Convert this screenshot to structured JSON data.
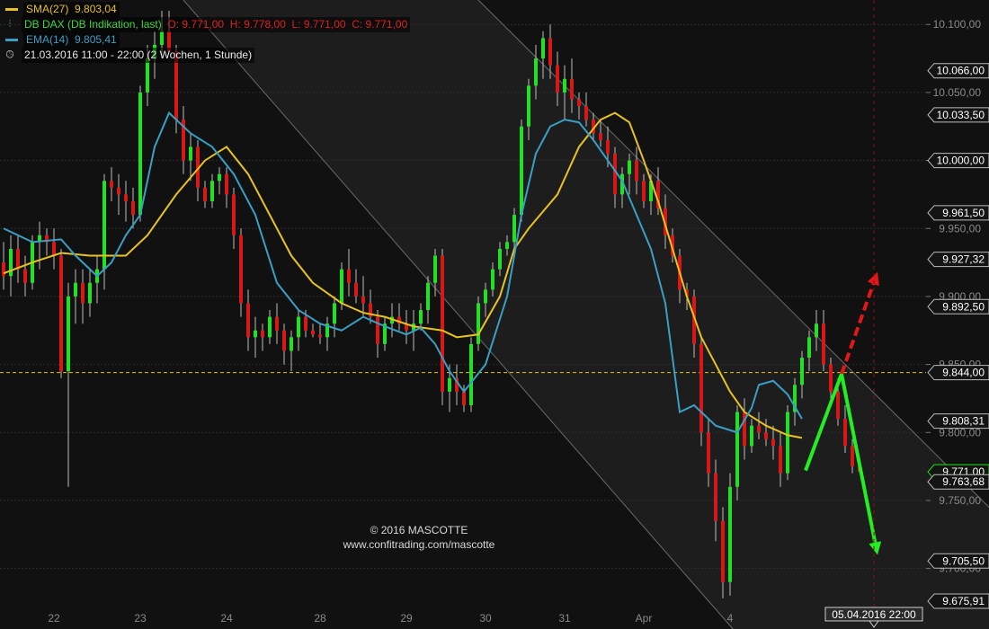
{
  "legend": {
    "sma_label": "SMA(27)",
    "sma_value": "9.803,04",
    "instrument_label": "DB DAX (DB Indikation, last)",
    "ohlc_text": "O: 9.771,00  H: 9.778,00  L: 9.771,00  C: 9.771,00",
    "ema_label": "EMA(14)",
    "ema_value": "9.805,41",
    "range_text": "21.03.2016 11:00 - 22:00 (2 Wochen, 1 Stunde)",
    "clock_icon": "clock-icon",
    "candle_icon": "candlestick-icon"
  },
  "watermark": {
    "line1": "© 2016 MASCOTTE",
    "line2": "www.confitrading.com/mascotte"
  },
  "colors": {
    "background": "#111111",
    "up": "#22e022",
    "down": "#d81818",
    "sma": "#e8c21e",
    "ema": "#3a9fc4",
    "channel": "#6a6a6a",
    "reference": "#e8c21e",
    "forecast_up": "#e01818",
    "forecast_down": "#22ee22"
  },
  "chart_data": {
    "type": "candlestick",
    "y_range": [
      9670,
      10118
    ],
    "y_ticks": [
      {
        "value": 10100,
        "label": "10.100,00"
      },
      {
        "value": 10050,
        "label": "10.050,00"
      },
      {
        "value": 10000,
        "label": "10.000,00"
      },
      {
        "value": 9950,
        "label": "9.950,00"
      },
      {
        "value": 9900,
        "label": "9.900,00"
      },
      {
        "value": 9850,
        "label": "9.850,00"
      },
      {
        "value": 9800,
        "label": "9.800,00"
      },
      {
        "value": 9750,
        "label": "9.750,00"
      },
      {
        "value": 9700,
        "label": "9.700,00"
      }
    ],
    "x_labels": [
      {
        "bar": 7,
        "label": "22"
      },
      {
        "bar": 19,
        "label": "23"
      },
      {
        "bar": 31,
        "label": "24"
      },
      {
        "bar": 44,
        "label": "28"
      },
      {
        "bar": 56,
        "label": "29"
      },
      {
        "bar": 67,
        "label": "30"
      },
      {
        "bar": 78,
        "label": "31"
      },
      {
        "bar": 89,
        "label": "Apr"
      },
      {
        "bar": 101,
        "label": "4"
      }
    ],
    "price_markers": [
      {
        "value": 10066,
        "label": "10.066,00",
        "style": "dark"
      },
      {
        "value": 10033.5,
        "label": "10.033,50",
        "style": "dark"
      },
      {
        "value": 10000,
        "label": "10.000,00",
        "style": "dark"
      },
      {
        "value": 9961.5,
        "label": "9.961,50",
        "style": "dark"
      },
      {
        "value": 9927.32,
        "label": "9.927,32",
        "style": "dark"
      },
      {
        "value": 9892.5,
        "label": "9.892,50",
        "style": "dark"
      },
      {
        "value": 9844,
        "label": "9.844,00",
        "style": "dark"
      },
      {
        "value": 9808.31,
        "label": "9.808,31",
        "style": "dark"
      },
      {
        "value": 9771,
        "label": "9.771,00",
        "style": "green"
      },
      {
        "value": 9763.68,
        "label": "9.763,68",
        "style": "dark"
      },
      {
        "value": 9705.5,
        "label": "9.705,50",
        "style": "dark"
      },
      {
        "value": 9675.91,
        "label": "9.675,91",
        "style": "dark"
      }
    ],
    "reference_line": {
      "value": 9844
    },
    "crosshair_label": "05.04.2016 22:00",
    "crosshair_bar": 121,
    "channel": {
      "upper": [
        {
          "bar": 66,
          "value": 10118
        },
        {
          "bar": 137,
          "value": 9745
        }
      ],
      "lower": [
        {
          "bar": 25,
          "value": 10118
        },
        {
          "bar": 99,
          "value": 9670
        }
      ]
    },
    "forecast": {
      "start": {
        "bar": 111.5,
        "value": 9772
      },
      "peak": {
        "bar": 116.5,
        "value": 9843
      },
      "up_target": {
        "bar": 121.5,
        "value": 9918
      },
      "down_target": {
        "bar": 121.5,
        "value": 9710
      }
    },
    "ohlc": [
      [
        9925,
        9940,
        9905,
        9915
      ],
      [
        9915,
        9945,
        9900,
        9935
      ],
      [
        9935,
        9945,
        9910,
        9920
      ],
      [
        9920,
        9930,
        9900,
        9910
      ],
      [
        9910,
        9945,
        9905,
        9940
      ],
      [
        9940,
        9955,
        9920,
        9945
      ],
      [
        9945,
        9950,
        9930,
        9940
      ],
      [
        9940,
        9950,
        9920,
        9930
      ],
      [
        9930,
        9935,
        9840,
        9845
      ],
      [
        9845,
        9910,
        9760,
        9900
      ],
      [
        9900,
        9920,
        9880,
        9910
      ],
      [
        9910,
        9920,
        9880,
        9895
      ],
      [
        9895,
        9920,
        9885,
        9910
      ],
      [
        9910,
        9930,
        9895,
        9920
      ],
      [
        9920,
        9990,
        9905,
        9985
      ],
      [
        9985,
        9995,
        9970,
        9980
      ],
      [
        9980,
        9990,
        9960,
        9975
      ],
      [
        9975,
        9985,
        9955,
        9970
      ],
      [
        9970,
        9980,
        9950,
        9960
      ],
      [
        9960,
        10055,
        9955,
        10050
      ],
      [
        10050,
        10085,
        10040,
        10075
      ],
      [
        10075,
        10095,
        10060,
        10085
      ],
      [
        10085,
        10110,
        10075,
        10095
      ],
      [
        10095,
        10110,
        10085,
        10080
      ],
      [
        10080,
        10085,
        10020,
        10030
      ],
      [
        10030,
        10040,
        9990,
        10000
      ],
      [
        10000,
        10020,
        9985,
        10010
      ],
      [
        10010,
        10015,
        9970,
        9980
      ],
      [
        9980,
        9985,
        9965,
        9970
      ],
      [
        9970,
        9990,
        9965,
        9985
      ],
      [
        9985,
        9995,
        9975,
        9990
      ],
      [
        9990,
        9995,
        9965,
        9975
      ],
      [
        9975,
        9980,
        9935,
        9945
      ],
      [
        9945,
        9950,
        9885,
        9895
      ],
      [
        9895,
        9905,
        9860,
        9870
      ],
      [
        9870,
        9885,
        9855,
        9875
      ],
      [
        9875,
        9880,
        9860,
        9870
      ],
      [
        9870,
        9890,
        9865,
        9885
      ],
      [
        9885,
        9895,
        9865,
        9875
      ],
      [
        9875,
        9880,
        9850,
        9860
      ],
      [
        9860,
        9875,
        9845,
        9870
      ],
      [
        9870,
        9890,
        9860,
        9885
      ],
      [
        9885,
        9890,
        9870,
        9875
      ],
      [
        9875,
        9880,
        9870,
        9872
      ],
      [
        9872,
        9880,
        9865,
        9870
      ],
      [
        9870,
        9885,
        9860,
        9880
      ],
      [
        9880,
        9900,
        9870,
        9895
      ],
      [
        9895,
        9925,
        9890,
        9920
      ],
      [
        9920,
        9935,
        9900,
        9910
      ],
      [
        9910,
        9920,
        9895,
        9900
      ],
      [
        9900,
        9915,
        9885,
        9895
      ],
      [
        9895,
        9905,
        9880,
        9885
      ],
      [
        9885,
        9890,
        9855,
        9865
      ],
      [
        9865,
        9885,
        9860,
        9880
      ],
      [
        9880,
        9895,
        9870,
        9885
      ],
      [
        9885,
        9895,
        9875,
        9880
      ],
      [
        9880,
        9890,
        9865,
        9875
      ],
      [
        9875,
        9890,
        9860,
        9880
      ],
      [
        9880,
        9895,
        9875,
        9890
      ],
      [
        9890,
        9915,
        9880,
        9910
      ],
      [
        9910,
        9935,
        9900,
        9930
      ],
      [
        9930,
        9935,
        9820,
        9830
      ],
      [
        9830,
        9850,
        9815,
        9840
      ],
      [
        9840,
        9850,
        9820,
        9830
      ],
      [
        9830,
        9835,
        9815,
        9820
      ],
      [
        9820,
        9870,
        9815,
        9865
      ],
      [
        9865,
        9900,
        9860,
        9895
      ],
      [
        9895,
        9910,
        9885,
        9905
      ],
      [
        9905,
        9925,
        9900,
        9920
      ],
      [
        9920,
        9940,
        9915,
        9935
      ],
      [
        9935,
        9945,
        9930,
        9940
      ],
      [
        9940,
        9965,
        9935,
        9960
      ],
      [
        9960,
        10030,
        9955,
        10025
      ],
      [
        10025,
        10060,
        10015,
        10055
      ],
      [
        10055,
        10085,
        10045,
        10075
      ],
      [
        10075,
        10095,
        10060,
        10090
      ],
      [
        10090,
        10100,
        10060,
        10070
      ],
      [
        10070,
        10080,
        10040,
        10050
      ],
      [
        10050,
        10070,
        10030,
        10060
      ],
      [
        10060,
        10075,
        10035,
        10045
      ],
      [
        10045,
        10050,
        10030,
        10040
      ],
      [
        10040,
        10050,
        10025,
        10030
      ],
      [
        10030,
        10035,
        10015,
        10020
      ],
      [
        10020,
        10030,
        10010,
        10015
      ],
      [
        10015,
        10025,
        9995,
        10005
      ],
      [
        10005,
        10010,
        9965,
        9975
      ],
      [
        9975,
        9995,
        9965,
        9990
      ],
      [
        9990,
        10005,
        9975,
        10000
      ],
      [
        10000,
        10010,
        9975,
        9985
      ],
      [
        9985,
        9990,
        9965,
        9970
      ],
      [
        9970,
        9990,
        9960,
        9985
      ],
      [
        9985,
        9995,
        9960,
        9965
      ],
      [
        9965,
        9975,
        9935,
        9945
      ],
      [
        9945,
        9950,
        9925,
        9930
      ],
      [
        9930,
        9935,
        9895,
        9905
      ],
      [
        9905,
        9910,
        9890,
        9900
      ],
      [
        9900,
        9905,
        9855,
        9865
      ],
      [
        9865,
        9870,
        9790,
        9800
      ],
      [
        9800,
        9810,
        9760,
        9770
      ],
      [
        9770,
        9780,
        9720,
        9735
      ],
      [
        9735,
        9745,
        9678,
        9690
      ],
      [
        9690,
        9770,
        9680,
        9760
      ],
      [
        9760,
        9820,
        9750,
        9815
      ],
      [
        9815,
        9825,
        9780,
        9790
      ],
      [
        9790,
        9810,
        9785,
        9805
      ],
      [
        9805,
        9815,
        9795,
        9800
      ],
      [
        9800,
        9810,
        9790,
        9795
      ],
      [
        9795,
        9805,
        9780,
        9790
      ],
      [
        9790,
        9800,
        9760,
        9770
      ],
      [
        9770,
        9820,
        9765,
        9815
      ],
      [
        9815,
        9840,
        9805,
        9835
      ],
      [
        9835,
        9860,
        9825,
        9855
      ],
      [
        9855,
        9875,
        9845,
        9870
      ],
      [
        9870,
        9890,
        9860,
        9880
      ],
      [
        9880,
        9890,
        9845,
        9850
      ],
      [
        9850,
        9855,
        9825,
        9830
      ],
      [
        9830,
        9840,
        9805,
        9810
      ],
      [
        9810,
        9820,
        9785,
        9790
      ],
      [
        9790,
        9795,
        9770,
        9775
      ],
      [
        9775,
        9780,
        9771,
        9771
      ]
    ],
    "sma": [
      [
        0,
        9917
      ],
      [
        4,
        9925
      ],
      [
        8,
        9932
      ],
      [
        12,
        9930
      ],
      [
        17,
        9930
      ],
      [
        20,
        9945
      ],
      [
        24,
        9975
      ],
      [
        28,
        10000
      ],
      [
        31,
        10010
      ],
      [
        34,
        9990
      ],
      [
        37,
        9960
      ],
      [
        40,
        9930
      ],
      [
        43,
        9910
      ],
      [
        47,
        9895
      ],
      [
        50,
        9888
      ],
      [
        53,
        9885
      ],
      [
        57,
        9878
      ],
      [
        61,
        9875
      ],
      [
        63,
        9870
      ],
      [
        66,
        9872
      ],
      [
        69,
        9900
      ],
      [
        71,
        9935
      ],
      [
        73,
        9950
      ],
      [
        77,
        9975
      ],
      [
        80,
        10010
      ],
      [
        83,
        10030
      ],
      [
        85,
        10035
      ],
      [
        87,
        10028
      ],
      [
        89,
        10000
      ],
      [
        91,
        9970
      ],
      [
        93,
        9935
      ],
      [
        95,
        9900
      ],
      [
        97,
        9870
      ],
      [
        99,
        9850
      ],
      [
        101,
        9830
      ],
      [
        103,
        9815
      ],
      [
        106,
        9805
      ],
      [
        109,
        9798
      ],
      [
        111,
        9796
      ]
    ],
    "ema": [
      [
        0,
        9950
      ],
      [
        4,
        9940
      ],
      [
        8,
        9942
      ],
      [
        10,
        9930
      ],
      [
        13,
        9915
      ],
      [
        15,
        9925
      ],
      [
        17,
        9945
      ],
      [
        19,
        9960
      ],
      [
        21,
        10010
      ],
      [
        23,
        10035
      ],
      [
        26,
        10020
      ],
      [
        29,
        10010
      ],
      [
        32,
        9990
      ],
      [
        35,
        9960
      ],
      [
        38,
        9910
      ],
      [
        41,
        9890
      ],
      [
        44,
        9880
      ],
      [
        47,
        9875
      ],
      [
        50,
        9885
      ],
      [
        53,
        9878
      ],
      [
        56,
        9872
      ],
      [
        58,
        9877
      ],
      [
        60,
        9865
      ],
      [
        62,
        9845
      ],
      [
        64,
        9830
      ],
      [
        67,
        9850
      ],
      [
        70,
        9900
      ],
      [
        72,
        9960
      ],
      [
        74,
        10005
      ],
      [
        76,
        10025
      ],
      [
        78,
        10030
      ],
      [
        80,
        10028
      ],
      [
        82,
        10015
      ],
      [
        84,
        10000
      ],
      [
        86,
        9985
      ],
      [
        88,
        9960
      ],
      [
        90,
        9935
      ],
      [
        92,
        9895
      ],
      [
        94,
        9815
      ],
      [
        96,
        9820
      ],
      [
        99,
        9805
      ],
      [
        102,
        9800
      ],
      [
        104,
        9818
      ],
      [
        105,
        9835
      ],
      [
        107,
        9838
      ],
      [
        109,
        9828
      ],
      [
        111,
        9810
      ]
    ]
  }
}
